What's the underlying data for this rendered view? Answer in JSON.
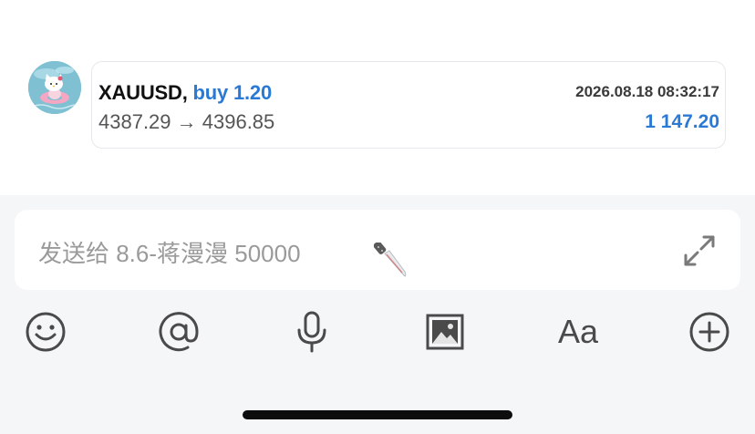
{
  "message": {
    "symbol": "XAUUSD,",
    "side": "buy",
    "volume": "1.20",
    "prices": "4387.29 → 4396.85",
    "timestamp": "2026.08.18 08:32:17",
    "profit": "1 147.20"
  },
  "composer": {
    "placeholder": "发送给 8.6-蒋漫漫 50000",
    "placeholder_emoji_icon": "kitchen-knife-icon",
    "expand_icon": "expand-arrows-icon"
  },
  "toolbar": {
    "emoji_icon": "smiley-face-icon",
    "mention_icon": "at-sign-icon",
    "voice_icon": "microphone-icon",
    "image_icon": "image-icon",
    "format_label": "Aa",
    "more_icon": "plus-circle-icon"
  },
  "colors": {
    "accent_blue": "#2a79d4",
    "composer_background": "#f4f6f8",
    "icon_gray": "#4a4a4a"
  }
}
